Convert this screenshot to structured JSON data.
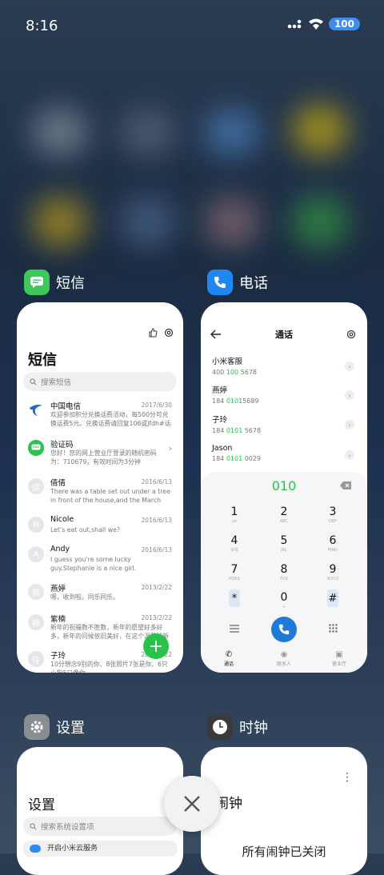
{
  "status_bar": {
    "time": "8:16",
    "battery": "100"
  },
  "apps": {
    "sms": {
      "label": "短信",
      "title": "短信",
      "search_placeholder": "搜索短信",
      "messages": [
        {
          "name": "中国电信",
          "date": "2017/6/30",
          "body": "欢迎参加积分兑换话费活动，每500分可兑换话费5元。兑换话费请回复106或jfdh#话费…",
          "avatar": ""
        },
        {
          "name": "验证码",
          "date": "",
          "body": "您好！您的网上营业厅登录的随机密码为：710679。有效时间为3分钟",
          "avatar": ""
        },
        {
          "name": "倩倩",
          "date": "2016/6/13",
          "body": "There was a table set out under a tree in front of the house,and the March Hare an…",
          "avatar": "倩"
        },
        {
          "name": "Nicole",
          "date": "2016/6/13",
          "body": "Let's eat out,shall we?",
          "avatar": "N"
        },
        {
          "name": "Andy",
          "date": "2016/6/13",
          "body": "I guess you're some lucky guy.Stephanie is a nice girl.",
          "avatar": "A"
        },
        {
          "name": "燕婷",
          "date": "2013/2/22",
          "body": "嗯，收到啦。同乐同乐。",
          "avatar": "燕"
        },
        {
          "name": "紫楠",
          "date": "2013/2/22",
          "body": "新年的祝福数不胜数，新年的愿望好多好多，新年的问候依旧美好，在这个温馨的新年…",
          "avatar": "楠"
        },
        {
          "name": "子玲",
          "date": "2013/2/22",
          "body": "10分想念9别的你、8张照片7张是你、6只小狗5只像你",
          "avatar": "玲"
        }
      ]
    },
    "phone": {
      "label": "电话",
      "title": "通话",
      "contacts": [
        {
          "name": "小米客服",
          "num_pre": "400 ",
          "num_hl": "100",
          "num_post": " 5678"
        },
        {
          "name": "燕婷",
          "num_pre": "184 ",
          "num_hl": "010",
          "num_post": "15689"
        },
        {
          "name": "子玲",
          "num_pre": "184 ",
          "num_hl": "0101",
          "num_post": " 5678"
        },
        {
          "name": "Jason",
          "num_pre": "184 ",
          "num_hl": "0101",
          "num_post": " 0029"
        }
      ],
      "dialed": "010",
      "keys": [
        {
          "d": "1",
          "l": "oo"
        },
        {
          "d": "2",
          "l": "ABC"
        },
        {
          "d": "3",
          "l": "DEF"
        },
        {
          "d": "4",
          "l": "GHI"
        },
        {
          "d": "5",
          "l": "JKL"
        },
        {
          "d": "6",
          "l": "MNO"
        },
        {
          "d": "7",
          "l": "PQRS"
        },
        {
          "d": "8",
          "l": "TUV"
        },
        {
          "d": "9",
          "l": "WXYZ"
        },
        {
          "d": "*",
          "l": ","
        },
        {
          "d": "0",
          "l": "+"
        },
        {
          "d": "#",
          "l": ""
        }
      ],
      "tabs": [
        "通话",
        "联系人",
        "营业厅"
      ]
    },
    "settings": {
      "label": "设置",
      "title": "设置",
      "search_placeholder": "搜索系统设置项",
      "first_item": "开启小米云服务"
    },
    "clock": {
      "label": "时钟",
      "title": "闹钟",
      "empty_text": "所有闹钟已关闭"
    }
  },
  "colors": {
    "accent_green": "#27c34a",
    "accent_blue": "#1e7ad8"
  }
}
